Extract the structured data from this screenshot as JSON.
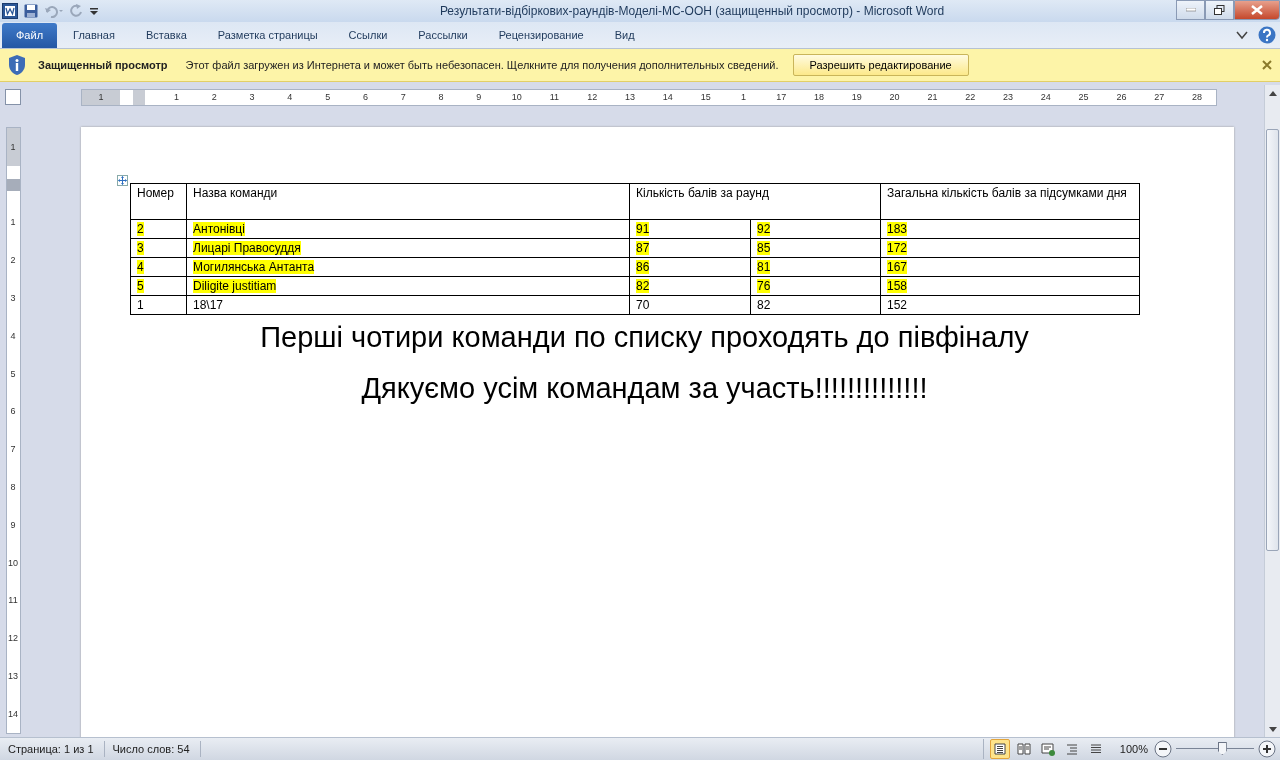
{
  "window": {
    "title": "Результати-відбіркових-раундів-Моделі-МС-ООН (защищенный просмотр)  -  Microsoft Word"
  },
  "ribbon_tabs": [
    {
      "label": "Файл",
      "selected": true
    },
    {
      "label": "Главная",
      "selected": false
    },
    {
      "label": "Вставка",
      "selected": false
    },
    {
      "label": "Разметка страницы",
      "selected": false
    },
    {
      "label": "Ссылки",
      "selected": false
    },
    {
      "label": "Рассылки",
      "selected": false
    },
    {
      "label": "Рецензирование",
      "selected": false
    },
    {
      "label": "Вид",
      "selected": false
    }
  ],
  "message_bar": {
    "title": "Защищенный просмотр",
    "text": "Этот файл загружен из Интернета и может быть небезопасен. Щелкните для получения дополнительных сведений.",
    "button": "Разрешить редактирование"
  },
  "ruler": {
    "left_numbers": [
      "1"
    ],
    "numbers": [
      "1",
      "2",
      "3",
      "4",
      "5",
      "6",
      "7",
      "8",
      "9",
      "10",
      "11",
      "12",
      "13",
      "14",
      "15",
      "1",
      "17",
      "18",
      "19",
      "20",
      "21",
      "22",
      "23",
      "24",
      "25",
      "26",
      "27",
      "28"
    ]
  },
  "vertical_ruler": {
    "top_numbers": [
      "1"
    ],
    "numbers": [
      "1",
      "2",
      "3",
      "4",
      "5",
      "6",
      "7",
      "8",
      "9",
      "10",
      "11",
      "12",
      "13",
      "14"
    ]
  },
  "table": {
    "columns": [
      {
        "label": "Номер",
        "kind": "single"
      },
      {
        "label": "Назва команди",
        "kind": "single"
      },
      {
        "label": "Кількість балів за раунд",
        "kind": "merged",
        "colspan": 2
      },
      {
        "label": "Загальна кількість балів за підсумками дня",
        "kind": "single"
      }
    ],
    "rows": [
      {
        "cells": [
          "2",
          "Антонівці",
          "91",
          "92",
          "183"
        ],
        "highlighted": true
      },
      {
        "cells": [
          "3",
          "Лицарі Правосуддя",
          "87",
          "85",
          "172"
        ],
        "highlighted": true
      },
      {
        "cells": [
          "4",
          "Могилянська Антанта",
          "86",
          "81",
          "167"
        ],
        "highlighted": true
      },
      {
        "cells": [
          "5",
          "Diligite  justitiam",
          "82",
          "76",
          "158"
        ],
        "highlighted": true
      },
      {
        "cells": [
          "1",
          "18\\17",
          "70",
          "82",
          "152"
        ],
        "highlighted": false
      }
    ]
  },
  "paragraphs": [
    "Перші чотири команди по списку проходять до півфіналу",
    "Дякуємо усім командам за участь!!!!!!!!!!!!!!"
  ],
  "status_bar": {
    "page": "Страница: 1 из 1",
    "words": "Число слов: 54",
    "views": [
      {
        "selected": true
      },
      {
        "selected": false
      },
      {
        "selected": false
      },
      {
        "selected": false
      },
      {
        "selected": false
      }
    ],
    "zoom": "100%",
    "zoom_slider": {
      "level": 0.6
    }
  }
}
